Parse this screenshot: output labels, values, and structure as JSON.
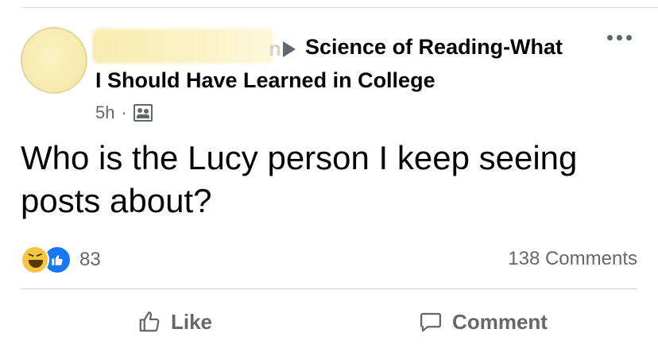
{
  "post": {
    "group_name_line1": "Science of Reading-What",
    "group_name_line2": "I Should Have Learned in College",
    "author_name_tail": "n",
    "timestamp": "5h",
    "meta_separator": "·",
    "audience_icon": "group-audience-icon",
    "text": "Who is the Lucy person I keep seeing posts about?"
  },
  "engagement": {
    "reactions": [
      "haha",
      "like"
    ],
    "reaction_count": "83",
    "comments_label": "138 Comments"
  },
  "actions": {
    "like_label": "Like",
    "comment_label": "Comment"
  },
  "colors": {
    "like_blue": "#1877f2",
    "haha_yellow": "#f7c53f",
    "secondary_text": "#65676b"
  }
}
